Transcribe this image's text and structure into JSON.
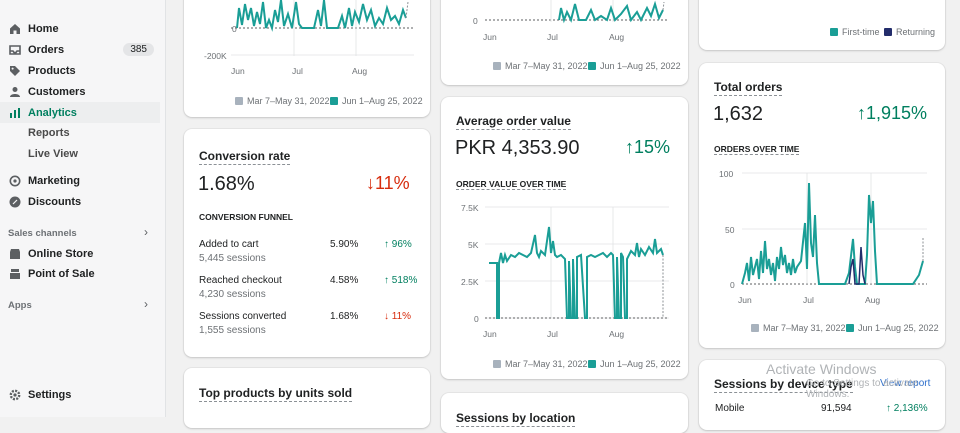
{
  "nav": {
    "home": "Home",
    "orders": "Orders",
    "orders_badge": "385",
    "products": "Products",
    "customers": "Customers",
    "analytics": "Analytics",
    "reports": "Reports",
    "live_view": "Live View",
    "marketing": "Marketing",
    "discounts": "Discounts",
    "sales_channels": "Sales channels",
    "online_store": "Online Store",
    "point_of_sale": "Point of Sale",
    "apps": "Apps",
    "settings": "Settings"
  },
  "colors": {
    "accent": "#007f5f",
    "series_current": "#1a9e96",
    "series_prev": "#a8b2bd",
    "returning": "#232d6b",
    "down": "#d72c0d"
  },
  "legend": {
    "prev": "Mar 7–May 31, 2022",
    "current": "Jun 1–Aug 25, 2022",
    "first_time": "First-time",
    "returning": "Returning"
  },
  "months": {
    "jun": "Jun",
    "jul": "Jul",
    "aug": "Aug"
  },
  "top_left_chart": {
    "y_ticks": [
      "0",
      "-200K"
    ]
  },
  "top_mid_chart": {
    "y_ticks": [
      "0"
    ]
  },
  "conversion": {
    "title": "Conversion rate",
    "value": "1.68%",
    "trend": "↓11%",
    "funnel_title": "CONVERSION FUNNEL",
    "rows": [
      {
        "name": "Added to cart",
        "sessions": "5,445 sessions",
        "pct": "5.90%",
        "change": "↑ 96%",
        "dir": "up"
      },
      {
        "name": "Reached checkout",
        "sessions": "4,230 sessions",
        "pct": "4.58%",
        "change": "↑ 518%",
        "dir": "up"
      },
      {
        "name": "Sessions converted",
        "sessions": "1,555 sessions",
        "pct": "1.68%",
        "change": "↓ 11%",
        "dir": "down"
      }
    ]
  },
  "aov": {
    "title": "Average order value",
    "value": "PKR 4,353.90",
    "trend": "↑15%",
    "sub": "ORDER VALUE OVER TIME",
    "y_ticks": [
      "7.5K",
      "5K",
      "2.5K",
      "0"
    ]
  },
  "total_orders": {
    "title": "Total orders",
    "value": "1,632",
    "trend": "↑1,915%",
    "sub": "ORDERS OVER TIME",
    "y_ticks": [
      "100",
      "50",
      "0"
    ]
  },
  "top_products": {
    "title": "Top products by units sold"
  },
  "sessions_location": {
    "title": "Sessions by location"
  },
  "sessions_device": {
    "title": "Sessions by device type",
    "view_report": "View report",
    "row_name": "Mobile",
    "row_value": "91,594",
    "row_change": "↑ 2,136%"
  },
  "watermark": {
    "line1": "Activate Windows",
    "line2": "Go to Settings to activate Windows."
  }
}
